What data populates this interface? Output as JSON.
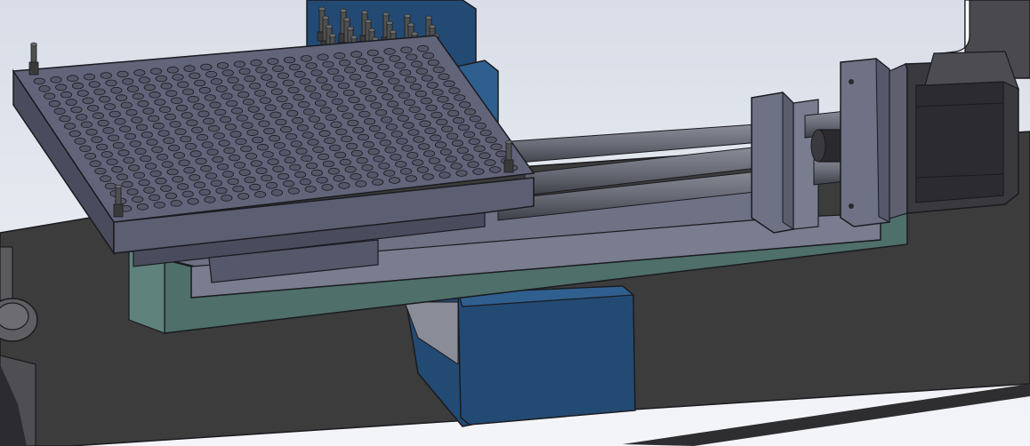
{
  "view": {
    "background_top": "#d8dde7",
    "background_bottom": "#f4f5f9",
    "colors": {
      "base_plate": "#3c3c3c",
      "frame_teal": "#4e6f6a",
      "frame_teal_light": "#5f827c",
      "mount_blue": "#234a73",
      "mount_blue_light": "#2f5f8f",
      "plate_top": "#62647a",
      "plate_side": "#4a4c5e",
      "rod": "#6a6c78",
      "motor": "#3a3a3e",
      "edge": "#1b1b1f"
    }
  },
  "parts": {
    "perforated_plate": {
      "hole_rows": 18,
      "hole_cols": 24,
      "corner_standoffs": 4
    },
    "pin_array": {
      "rows": 6,
      "cols": 6
    },
    "linear_rail": {
      "rods": 3
    },
    "stepper_motor": {
      "shown": true
    }
  }
}
